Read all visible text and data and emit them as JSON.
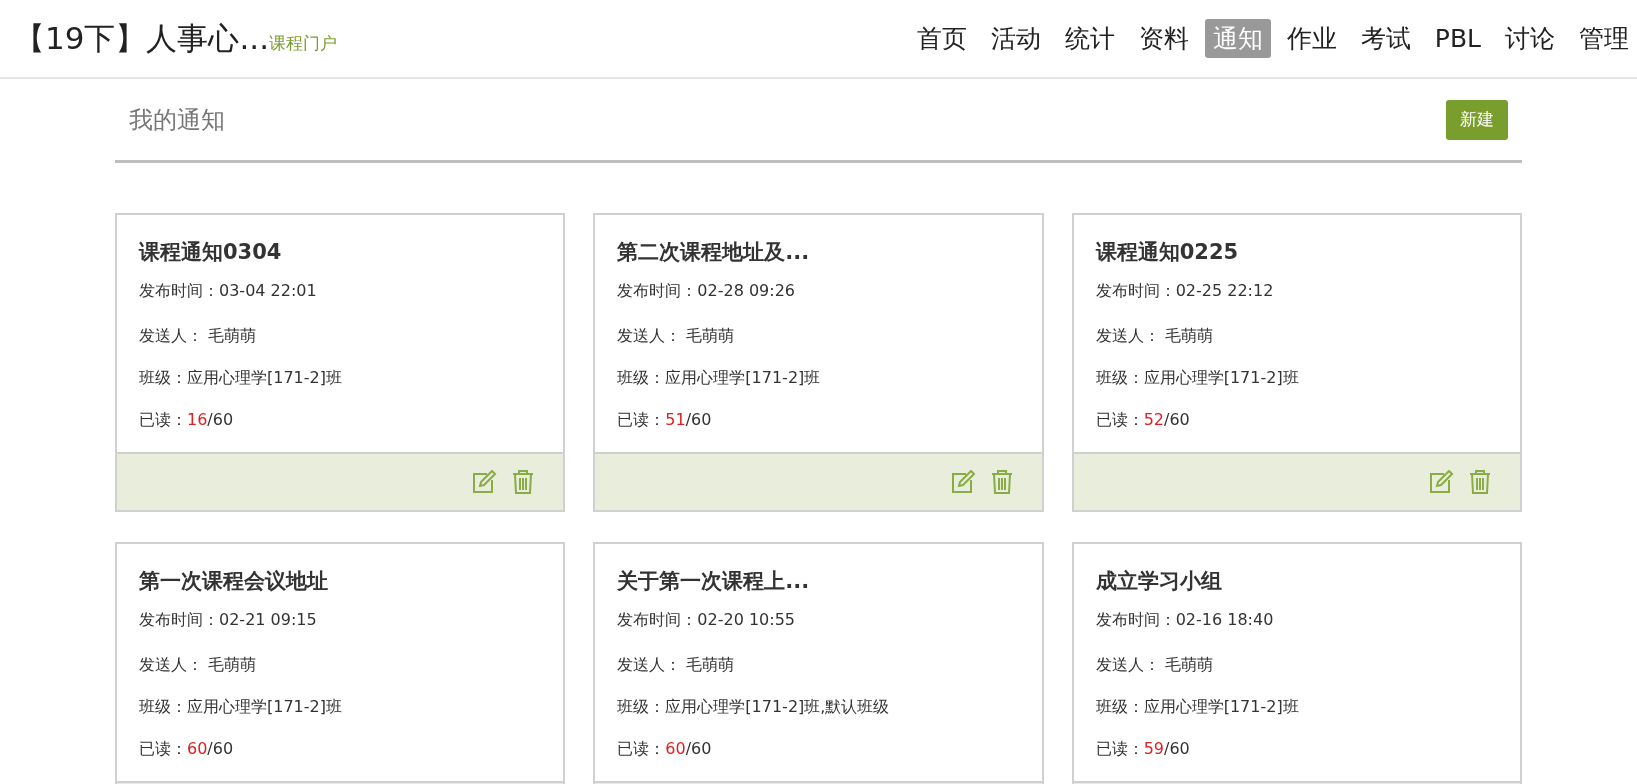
{
  "header": {
    "course_title": "【19下】人事心...",
    "portal_link": "课程门户"
  },
  "nav": [
    {
      "label": "首页",
      "selected": false
    },
    {
      "label": "活动",
      "selected": false
    },
    {
      "label": "统计",
      "selected": false
    },
    {
      "label": "资料",
      "selected": false
    },
    {
      "label": "通知",
      "selected": true
    },
    {
      "label": "作业",
      "selected": false
    },
    {
      "label": "考试",
      "selected": false
    },
    {
      "label": "PBL",
      "selected": false
    },
    {
      "label": "讨论",
      "selected": false
    },
    {
      "label": "管理",
      "selected": false
    }
  ],
  "section": {
    "title": "我的通知",
    "new_button": "新建"
  },
  "notices": [
    {
      "title": "课程通知0304",
      "time_label": "发布时间：",
      "time": "03-04 22:01",
      "sender_label": "发送人：",
      "sender": "毛萌萌",
      "class_label": "班级：",
      "class": "应用心理学[171-2]班",
      "read_label": "已读：",
      "read_count": "16",
      "read_total": "/60"
    },
    {
      "title": "第二次课程地址及...",
      "time_label": "发布时间：",
      "time": "02-28 09:26",
      "sender_label": "发送人：",
      "sender": "毛萌萌",
      "class_label": "班级：",
      "class": "应用心理学[171-2]班",
      "read_label": "已读：",
      "read_count": "51",
      "read_total": "/60"
    },
    {
      "title": "课程通知0225",
      "time_label": "发布时间：",
      "time": "02-25 22:12",
      "sender_label": "发送人：",
      "sender": "毛萌萌",
      "class_label": "班级：",
      "class": "应用心理学[171-2]班",
      "read_label": "已读：",
      "read_count": "52",
      "read_total": "/60"
    },
    {
      "title": "第一次课程会议地址",
      "time_label": "发布时间：",
      "time": "02-21 09:15",
      "sender_label": "发送人：",
      "sender": "毛萌萌",
      "class_label": "班级：",
      "class": "应用心理学[171-2]班",
      "read_label": "已读：",
      "read_count": "60",
      "read_total": "/60"
    },
    {
      "title": "关于第一次课程上...",
      "time_label": "发布时间：",
      "time": "02-20 10:55",
      "sender_label": "发送人：",
      "sender": "毛萌萌",
      "class_label": "班级：",
      "class": "应用心理学[171-2]班,默认班级",
      "read_label": "已读：",
      "read_count": "60",
      "read_total": "/60"
    },
    {
      "title": "成立学习小组",
      "time_label": "发布时间：",
      "time": "02-16 18:40",
      "sender_label": "发送人：",
      "sender": "毛萌萌",
      "class_label": "班级：",
      "class": "应用心理学[171-2]班",
      "read_label": "已读：",
      "read_count": "59",
      "read_total": "/60"
    }
  ]
}
